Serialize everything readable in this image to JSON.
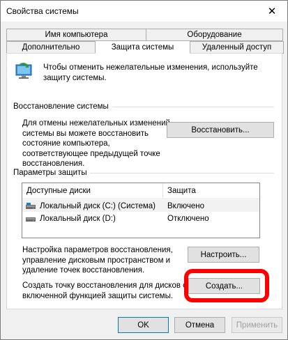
{
  "window": {
    "title": "Свойства системы",
    "close_glyph": "✕"
  },
  "tabs": {
    "row1": [
      {
        "label": "Имя компьютера"
      },
      {
        "label": "Оборудование"
      }
    ],
    "row2": [
      {
        "label": "Дополнительно"
      },
      {
        "label": "Защита системы",
        "active": true
      },
      {
        "label": "Удаленный доступ"
      }
    ]
  },
  "intro": {
    "text_line1": "Чтобы отменить нежелательные изменения, используйте",
    "text_line2": "защиту системы.",
    "icon": "system-protection-icon"
  },
  "restore": {
    "heading": "Восстановление системы",
    "desc_lines": [
      "Для отмены нежелательных изменений",
      "системы вы можете восстановить",
      "состояние компьютера,",
      "соответствующее предыдущей точке",
      "восстановления."
    ],
    "button_label": "Восстановить..."
  },
  "protection": {
    "heading": "Параметры защиты",
    "columns": [
      "Доступные диски",
      "Защита"
    ],
    "drives": [
      {
        "name": "Локальный диск (C:) (Система)",
        "status": "Включено",
        "icon": "system-drive-icon"
      },
      {
        "name": "Локальный диск (D:)",
        "status": "Отключено",
        "icon": "drive-icon"
      }
    ]
  },
  "configure": {
    "desc_lines": [
      "Настройка параметров восстановления,",
      "управление дисковым пространством и",
      "удаление точек восстановления."
    ],
    "button_label": "Настроить..."
  },
  "create": {
    "desc_lines": [
      "Создать точку восстановления для дисков с",
      "включенной функцией защиты системы."
    ],
    "button_label": "Создать..."
  },
  "footer": {
    "ok_label": "OK",
    "cancel_label": "Отмена",
    "apply_label": "Применить"
  },
  "colors": {
    "annotation_ring": "#ff0000",
    "focus_border": "#0078d7"
  }
}
